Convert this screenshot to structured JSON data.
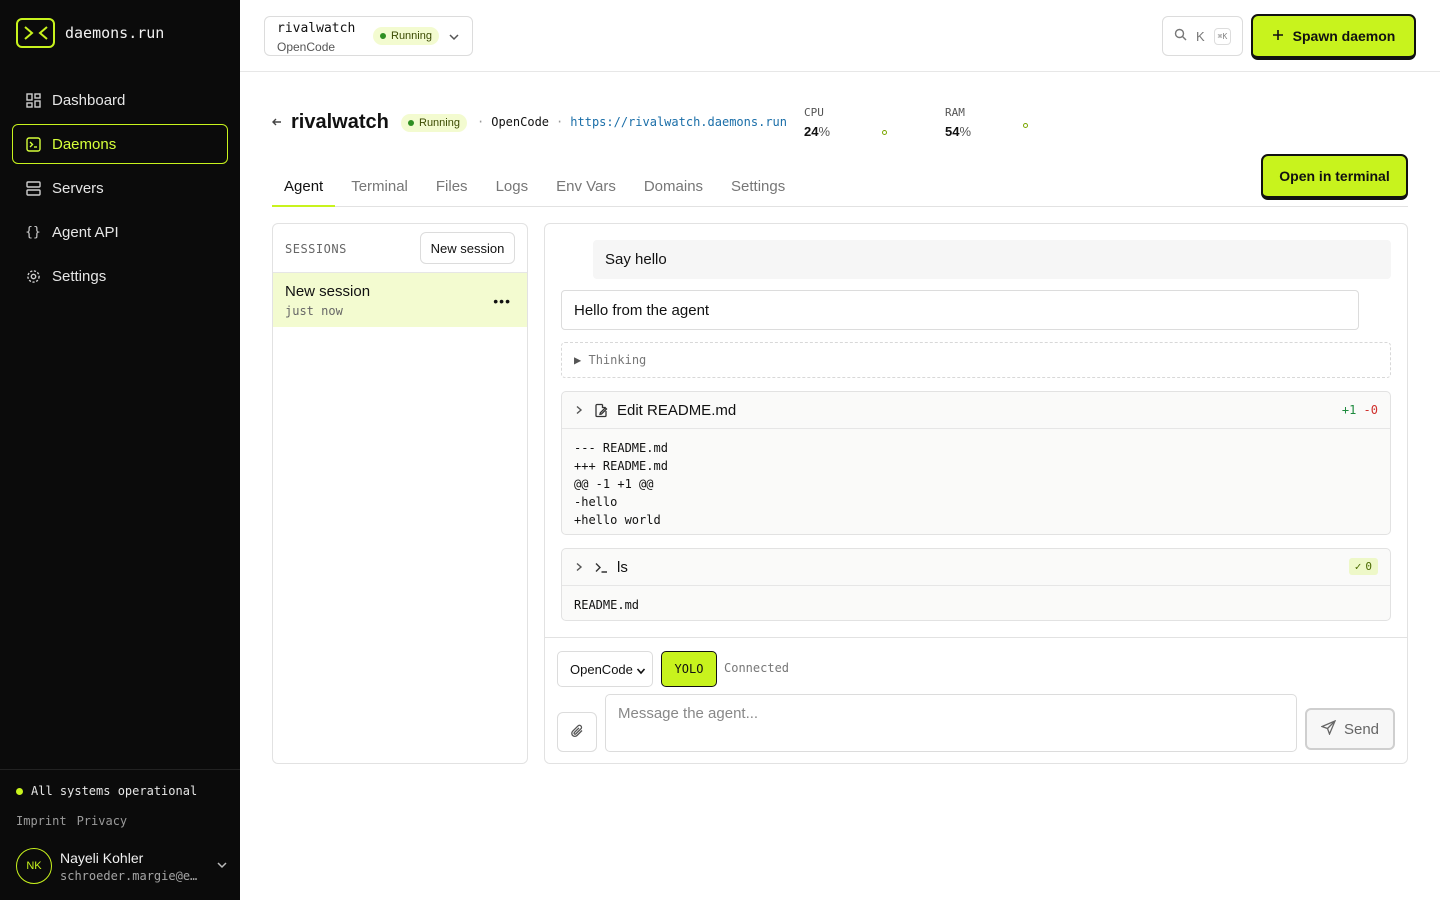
{
  "brand": {
    "name": "daemons.run",
    "accent": "#c8f31d"
  },
  "sidebar": {
    "items": [
      {
        "label": "Dashboard",
        "icon": "dashboard-icon"
      },
      {
        "label": "Daemons",
        "icon": "terminal-square-icon",
        "active": true
      },
      {
        "label": "Servers",
        "icon": "server-icon"
      },
      {
        "label": "Agent API",
        "icon": "braces-icon"
      },
      {
        "label": "Settings",
        "icon": "gear-icon"
      }
    ],
    "status": "All systems operational",
    "links": [
      "Imprint",
      "Privacy"
    ],
    "user": {
      "initials": "NK",
      "name": "Nayeli Kohler",
      "email": "schroeder.margie@e…"
    }
  },
  "topbar": {
    "daemon_name": "rivalwatch",
    "daemon_type": "OpenCode",
    "status": "Running",
    "search_key": "K",
    "search_shortcut": "⌘K",
    "spawn_label": "Spawn daemon"
  },
  "daemon": {
    "title": "rivalwatch",
    "status": "Running",
    "type": "OpenCode",
    "url": "https://rivalwatch.daemons.run",
    "cpu_label": "CPU",
    "cpu_value": "24",
    "ram_label": "RAM",
    "ram_value": "54",
    "pct": "%",
    "open_terminal": "Open in terminal"
  },
  "tabs": [
    "Agent",
    "Terminal",
    "Files",
    "Logs",
    "Env Vars",
    "Domains",
    "Settings"
  ],
  "sessions": {
    "heading": "SESSIONS",
    "new_label": "New session",
    "items": [
      {
        "name": "New session",
        "time": "just now"
      }
    ]
  },
  "chat": {
    "user_message": "Say hello",
    "agent_message": "Hello from the agent",
    "thinking_label": "Thinking",
    "edit_tool": {
      "title": "Edit README.md",
      "added": "+1",
      "removed": "-0",
      "diff": "--- README.md\n+++ README.md\n@@ -1 +1 @@\n-hello\n+hello world"
    },
    "shell_tool": {
      "title": "ls",
      "exit_code": "0",
      "output": "README.md"
    },
    "composer": {
      "model": "OpenCode",
      "mode": "YOLO",
      "connection": "Connected",
      "placeholder": "Message the agent...",
      "send_label": "Send"
    }
  }
}
